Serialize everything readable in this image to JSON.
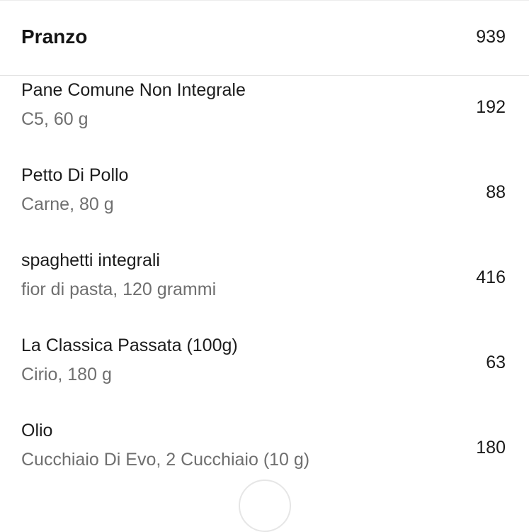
{
  "meal": {
    "title": "Pranzo",
    "total_calories": "939"
  },
  "items": [
    {
      "name": "Pane Comune Non Integrale",
      "detail": "C5, 60 g",
      "calories": "192"
    },
    {
      "name": "Petto Di Pollo",
      "detail": "Carne, 80 g",
      "calories": "88"
    },
    {
      "name": "spaghetti integrali",
      "detail": "fior di pasta, 120 grammi",
      "calories": "416"
    },
    {
      "name": "La Classica Passata (100g)",
      "detail": "Cirio, 180 g",
      "calories": "63"
    },
    {
      "name": "Olio",
      "detail": "Cucchiaio Di Evo, 2 Cucchiaio (10 g)",
      "calories": "180"
    }
  ]
}
